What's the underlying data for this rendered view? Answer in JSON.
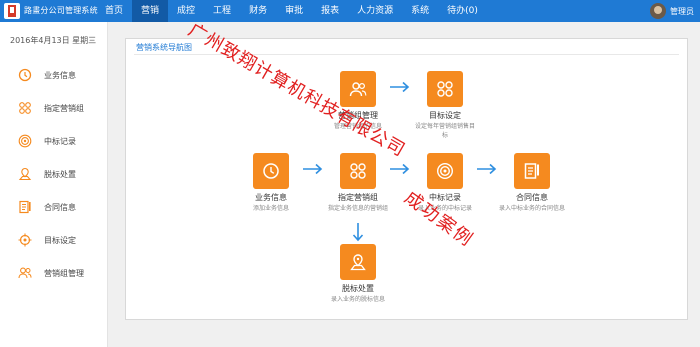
{
  "header": {
    "app_title": "路畫分公司管理系统",
    "nav": [
      "首页",
      "营销",
      "成控",
      "工程",
      "财务",
      "审批",
      "报表",
      "人力资源",
      "系统",
      "待办(0)"
    ],
    "active_nav": "营销",
    "user_name": "管理员"
  },
  "sidebar": {
    "date": "2016年4月13日 星期三",
    "items": [
      {
        "label": "业务信息",
        "icon": "clock-icon"
      },
      {
        "label": "指定营销组",
        "icon": "group-icon"
      },
      {
        "label": "中标记录",
        "icon": "target-icon"
      },
      {
        "label": "脱标处置",
        "icon": "pin-icon"
      },
      {
        "label": "合同信息",
        "icon": "document-icon"
      },
      {
        "label": "目标设定",
        "icon": "crosshair-icon"
      },
      {
        "label": "营销组管理",
        "icon": "users-icon"
      }
    ]
  },
  "main": {
    "title": "营销系统导航图",
    "nodes": {
      "team_mgmt": {
        "title": "营销组管理",
        "desc": "管理营销组的信息"
      },
      "target": {
        "title": "目标设定",
        "desc": "设定每年营销组销售目标"
      },
      "business": {
        "title": "业务信息",
        "desc": "添加业务信息"
      },
      "assign": {
        "title": "指定营销组",
        "desc": "指定业务信息的营销组"
      },
      "bid": {
        "title": "中标记录",
        "desc": "录入业务的中标记录"
      },
      "contract": {
        "title": "合同信息",
        "desc": "录入中标业务的合同信息"
      },
      "lost": {
        "title": "脱标处置",
        "desc": "录入业务的脱标信息"
      }
    }
  },
  "watermark": {
    "line1": "广州致翔计算机科技有限公司",
    "line2": "成功案例"
  },
  "colors": {
    "nav_bg": "#1f7ad4",
    "nav_active": "#125aa6",
    "node_orange": "#f58a1f",
    "arrow_blue": "#2f8fe0",
    "watermark_red": "#e12020"
  }
}
